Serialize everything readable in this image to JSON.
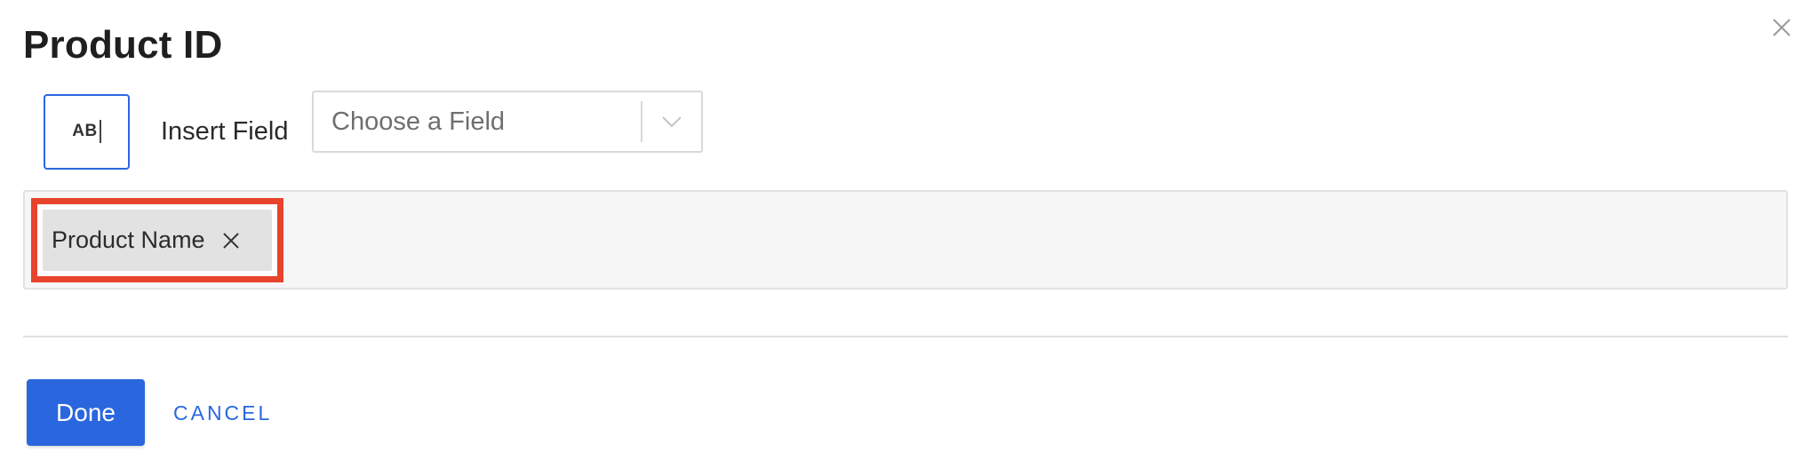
{
  "dialog": {
    "title": "Product ID"
  },
  "toolbar": {
    "text_mode_label": "AB",
    "insert_field_label": "Insert Field",
    "field_select": {
      "placeholder": "Choose a Field"
    }
  },
  "formula": {
    "tokens": [
      {
        "label": "Product Name"
      }
    ]
  },
  "footer": {
    "done_label": "Done",
    "cancel_label": "CANCEL"
  },
  "colors": {
    "accent": "#2a67de",
    "highlight": "#e8432c"
  }
}
